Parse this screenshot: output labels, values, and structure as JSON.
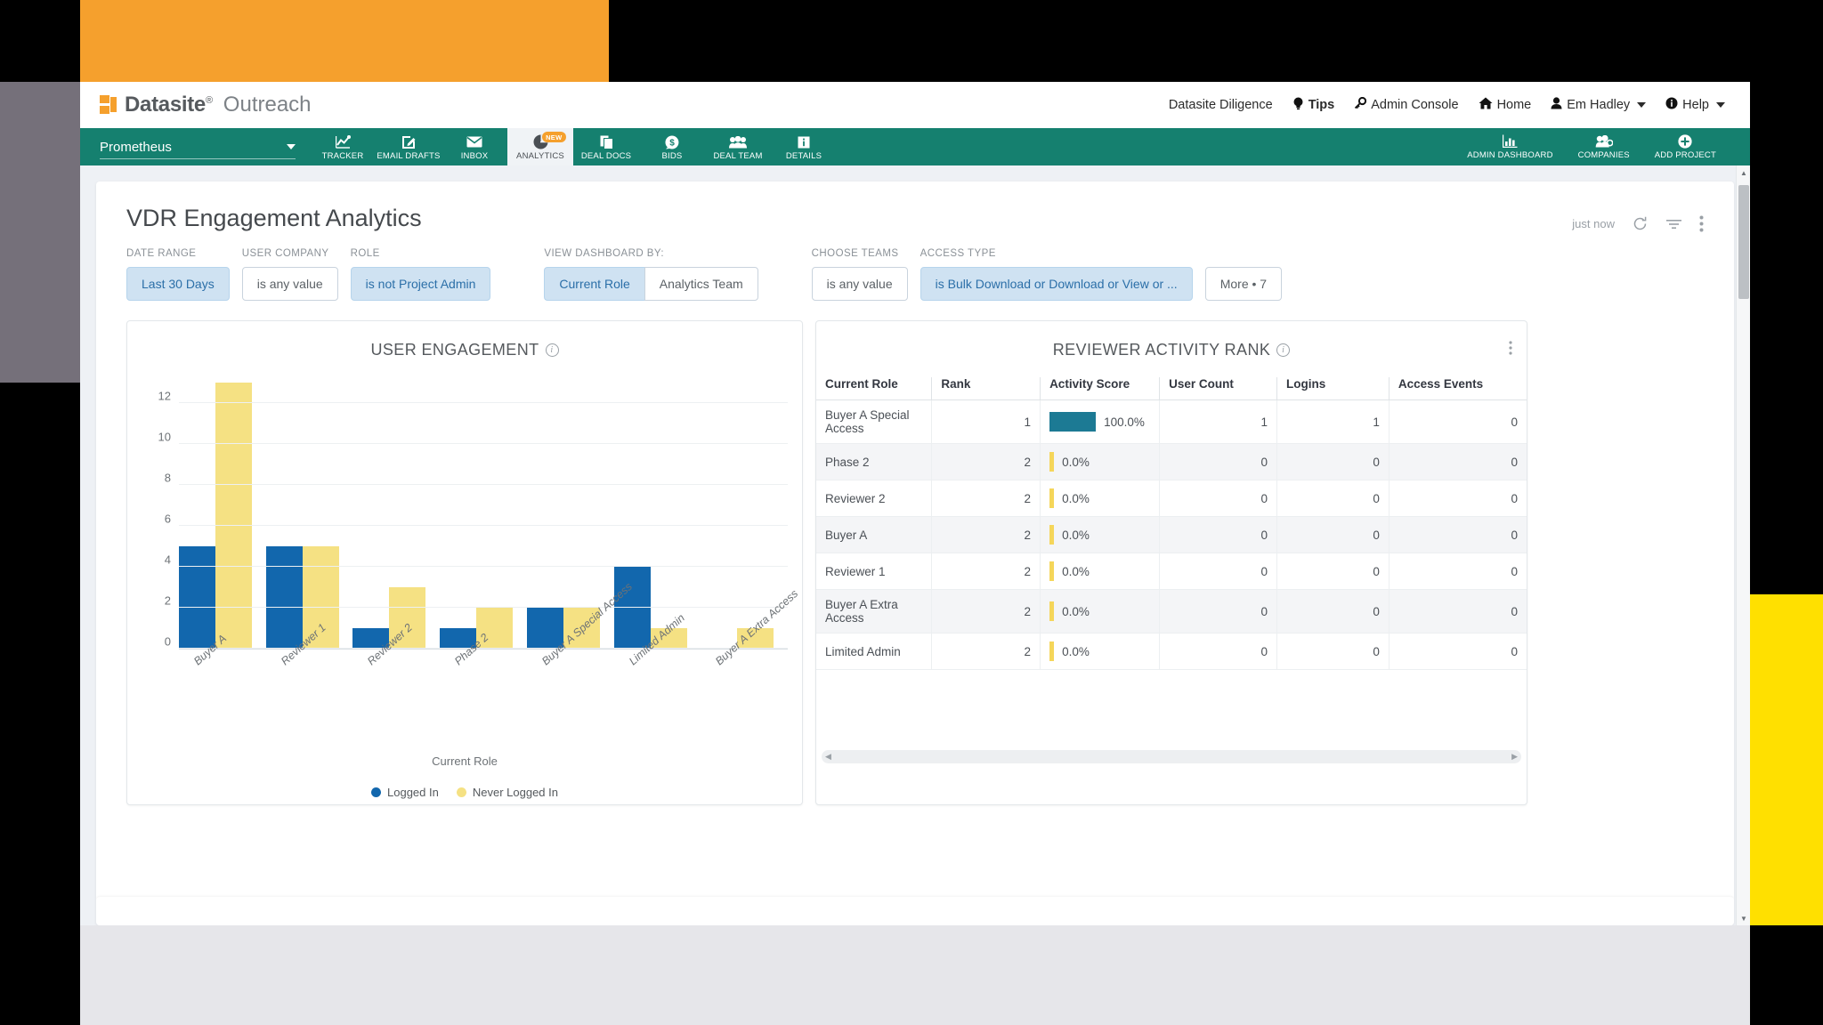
{
  "decor": {
    "orange": "#f5a02d",
    "gray": "#75707a",
    "yellow": "#ffe000",
    "bottom": "#e6e6ea"
  },
  "brand": {
    "name": "Datasite",
    "registered": "®",
    "product": "Outreach",
    "logo_icon": "datasite-logo-icon"
  },
  "topnav": {
    "org": "Datasite Diligence",
    "items": [
      {
        "label": "Tips",
        "icon": "lightbulb-icon",
        "bold": true
      },
      {
        "label": "Admin Console",
        "icon": "key-icon",
        "bold": false
      },
      {
        "label": "Home",
        "icon": "home-icon",
        "bold": false
      },
      {
        "label": "Em Hadley",
        "icon": "user-icon",
        "bold": false,
        "caret": true
      },
      {
        "label": "Help",
        "icon": "info-circle-icon",
        "bold": false,
        "caret": true
      }
    ]
  },
  "projectbar": {
    "project": "Prometheus",
    "tabs": [
      {
        "label": "TRACKER",
        "icon": "chart-line-icon",
        "active": false,
        "badge": null
      },
      {
        "label": "EMAIL DRAFTS",
        "icon": "pencil-square-icon",
        "active": false,
        "badge": null
      },
      {
        "label": "INBOX",
        "icon": "envelope-icon",
        "active": false,
        "badge": null
      },
      {
        "label": "ANALYTICS",
        "icon": "pie-chart-icon",
        "active": true,
        "badge": "NEW"
      },
      {
        "label": "DEAL DOCS",
        "icon": "documents-icon",
        "active": false,
        "badge": null
      },
      {
        "label": "BIDS",
        "icon": "dollar-circle-icon",
        "active": false,
        "badge": null
      },
      {
        "label": "DEAL TEAM",
        "icon": "people-icon",
        "active": false,
        "badge": null
      },
      {
        "label": "DETAILS",
        "icon": "info-square-icon",
        "active": false,
        "badge": null
      }
    ],
    "right_tabs": [
      {
        "label": "ADMIN DASHBOARD",
        "icon": "bar-chart-box-icon"
      },
      {
        "label": "COMPANIES",
        "icon": "companies-icon"
      },
      {
        "label": "ADD PROJECT",
        "icon": "plus-circle-icon"
      }
    ]
  },
  "page": {
    "title": "VDR Engagement Analytics",
    "updated": "just now",
    "tools": [
      {
        "name": "refresh-icon"
      },
      {
        "name": "filter-icon"
      },
      {
        "name": "kebab-menu-icon"
      }
    ]
  },
  "filters": [
    {
      "label": "DATE RANGE",
      "value": "Last 30 Days",
      "selected": true,
      "split": null
    },
    {
      "label": "USER COMPANY",
      "value": "is any value",
      "selected": false,
      "split": null
    },
    {
      "label": "ROLE",
      "value": "is not Project Admin",
      "selected": true,
      "split": null
    },
    {
      "label": "VIEW DASHBOARD BY:",
      "value": "Current Role",
      "selected": true,
      "split": "Analytics Team"
    },
    {
      "label": "CHOOSE TEAMS",
      "value": "is any value",
      "selected": false,
      "split": null
    },
    {
      "label": "ACCESS TYPE",
      "value": "is Bulk Download or Download or View or ...",
      "selected": true,
      "split": null
    }
  ],
  "more_filters": "More • 7",
  "chart_data": {
    "type": "bar",
    "title": "USER ENGAGEMENT",
    "xlabel": "Current Role",
    "ylabel": "",
    "ylim": [
      0,
      13
    ],
    "yticks": [
      0,
      2,
      4,
      6,
      8,
      10,
      12
    ],
    "grid": true,
    "legend_position": "bottom",
    "categories": [
      "Buyer A",
      "Reviewer 1",
      "Reviewer 2",
      "Phase 2",
      "Buyer A Special Access",
      "Limited Admin",
      "Buyer A Extra Access"
    ],
    "series": [
      {
        "name": "Logged In",
        "color": "#1267ad",
        "values": [
          5,
          5,
          1,
          1,
          2,
          4,
          0
        ]
      },
      {
        "name": "Never Logged In",
        "color": "#f5e183",
        "values": [
          13,
          5,
          3,
          2,
          2,
          1,
          1
        ]
      }
    ]
  },
  "table": {
    "title": "REVIEWER ACTIVITY RANK",
    "columns": [
      "Current Role",
      "Rank",
      "Activity Score",
      "User Count",
      "Logins",
      "Access Events"
    ],
    "rows": [
      {
        "role": "Buyer A Special Access",
        "rank": "1",
        "score": "100.0%",
        "score_pct": 100,
        "users": "1",
        "logins": "1",
        "access": "0"
      },
      {
        "role": "Phase 2",
        "rank": "2",
        "score": "0.0%",
        "score_pct": 0,
        "users": "0",
        "logins": "0",
        "access": "0"
      },
      {
        "role": "Reviewer 2",
        "rank": "2",
        "score": "0.0%",
        "score_pct": 0,
        "users": "0",
        "logins": "0",
        "access": "0"
      },
      {
        "role": "Buyer A",
        "rank": "2",
        "score": "0.0%",
        "score_pct": 0,
        "users": "0",
        "logins": "0",
        "access": "0"
      },
      {
        "role": "Reviewer 1",
        "rank": "2",
        "score": "0.0%",
        "score_pct": 0,
        "users": "0",
        "logins": "0",
        "access": "0"
      },
      {
        "role": "Buyer A Extra Access",
        "rank": "2",
        "score": "0.0%",
        "score_pct": 0,
        "users": "0",
        "logins": "0",
        "access": "0"
      },
      {
        "role": "Limited Admin",
        "rank": "2",
        "score": "0.0%",
        "score_pct": 0,
        "users": "0",
        "logins": "0",
        "access": "0"
      }
    ]
  }
}
